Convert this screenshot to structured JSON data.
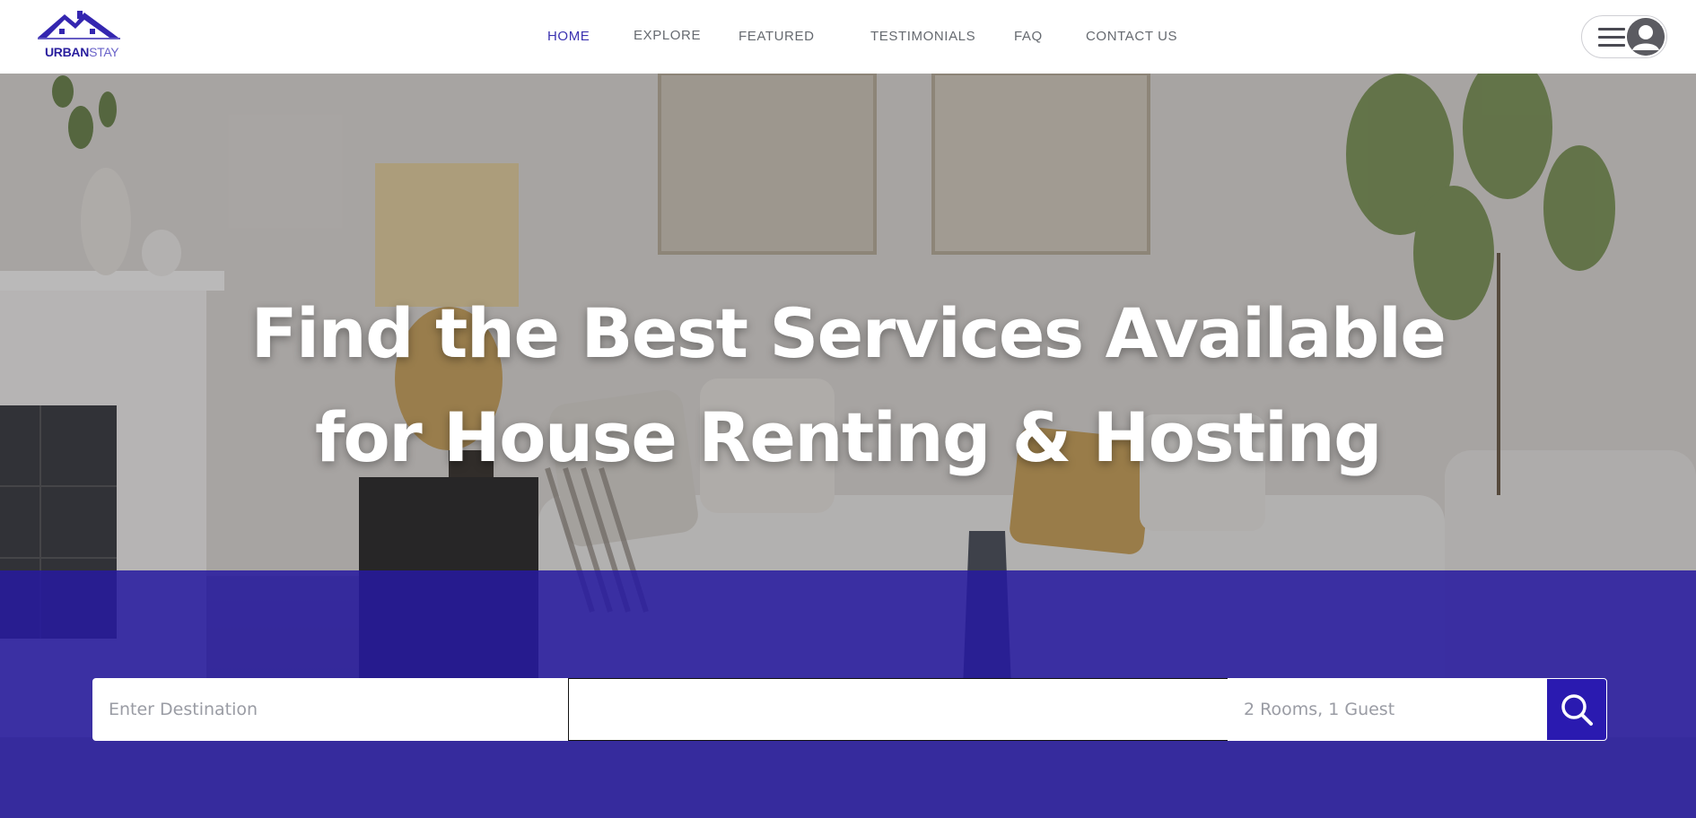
{
  "brand": {
    "logo_bold": "URBAN",
    "logo_light": "STAY",
    "logo_icon": "house-roof-icon",
    "color_primary": "#2a1ab0",
    "color_nav_active": "#3b32b0"
  },
  "nav": {
    "items": [
      {
        "label": "HOME",
        "active": true
      },
      {
        "label": "EXPLORE",
        "active": false
      },
      {
        "label": "FEATURED",
        "active": false
      },
      {
        "label": "TESTIMONIALS",
        "active": false
      },
      {
        "label": "FAQ",
        "active": false
      },
      {
        "label": "CONTACT US",
        "active": false
      }
    ]
  },
  "user_menu": {
    "menu_icon": "hamburger-icon",
    "avatar_icon": "user-avatar-icon"
  },
  "hero": {
    "headline_line1": "Find the Best Services Available",
    "headline_line2": "for House Renting & Hosting"
  },
  "search": {
    "destination_placeholder": "Enter Destination",
    "dates_value": "",
    "guests_placeholder": "2 Rooms, 1 Guest",
    "button_icon": "search-icon"
  }
}
